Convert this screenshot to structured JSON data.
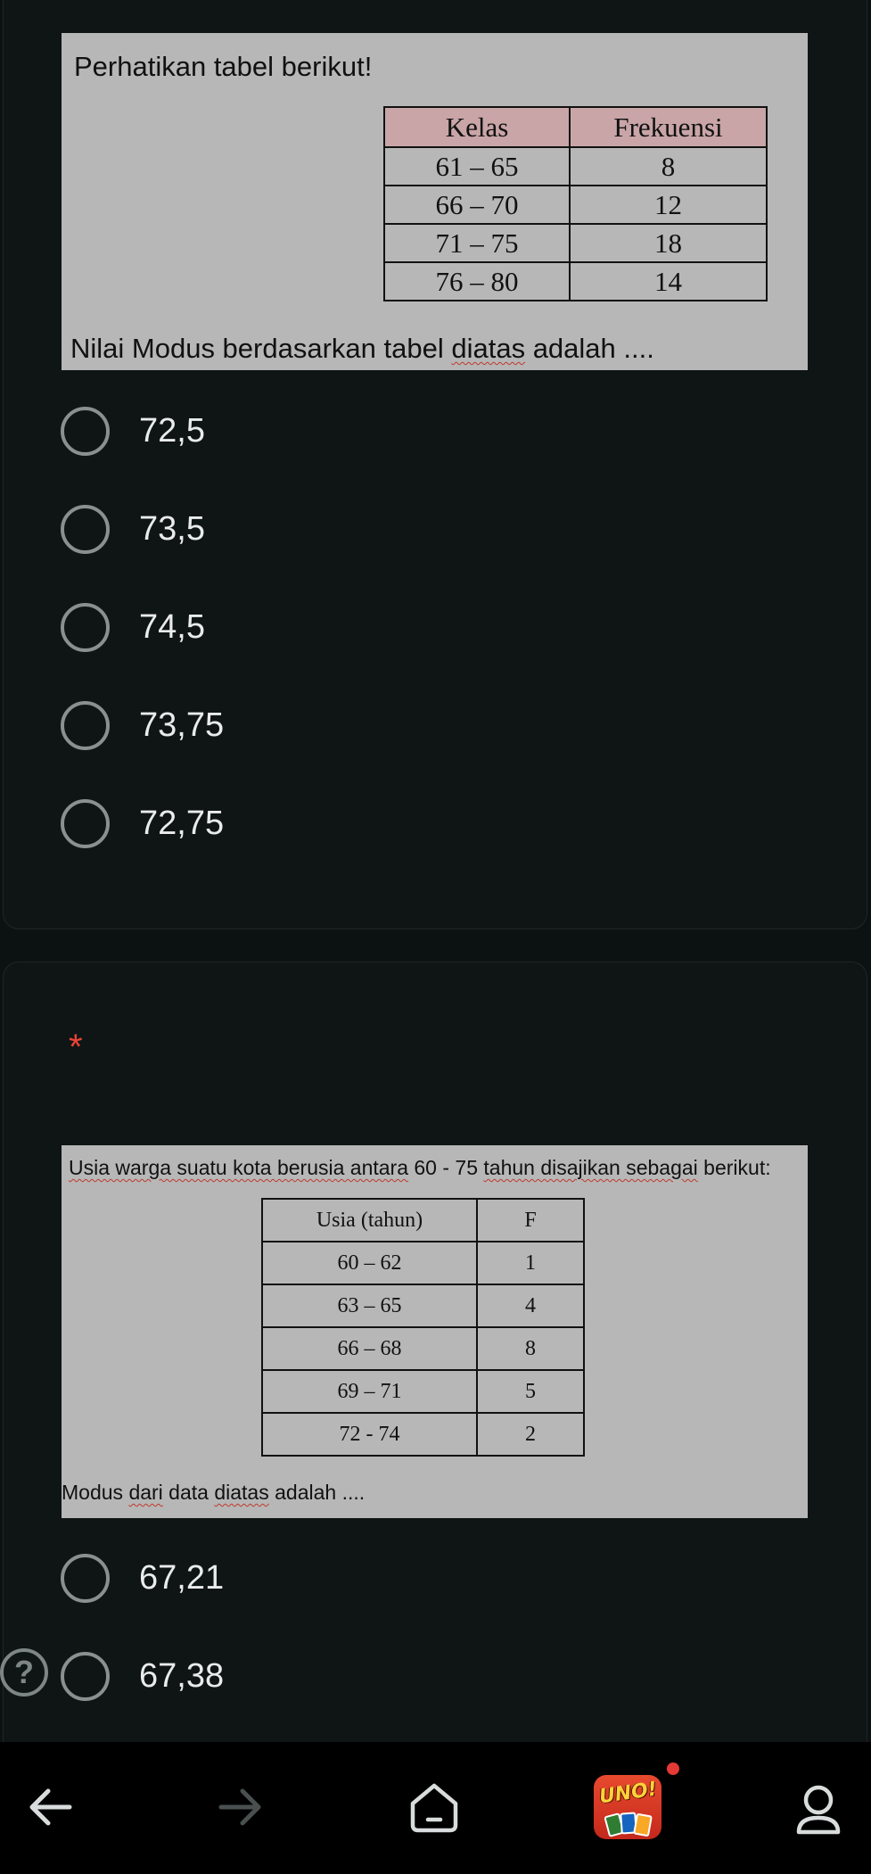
{
  "question1": {
    "image": {
      "heading": "Perhatikan tabel berikut!",
      "table": {
        "headers": [
          "Kelas",
          "Frekuensi"
        ],
        "rows": [
          [
            "61 – 65",
            "8"
          ],
          [
            "66 – 70",
            "12"
          ],
          [
            "71 – 75",
            "18"
          ],
          [
            "76 – 80",
            "14"
          ]
        ]
      },
      "prompt_before": "Nilai Modus berdasarkan tabel ",
      "prompt_squiggle": "diatas",
      "prompt_after": " adalah ...."
    },
    "options": [
      "72,5",
      "73,5",
      "74,5",
      "73,75",
      "72,75"
    ]
  },
  "question2": {
    "required_marker": "*",
    "image": {
      "heading_parts": [
        {
          "text": "Usia warga suatu kota berusia antara",
          "squiggle": true
        },
        {
          "text": " 60 - 75 ",
          "squiggle": false
        },
        {
          "text": "tahun disajikan sebagai",
          "squiggle": true
        },
        {
          "text": " berikut:",
          "squiggle": false
        }
      ],
      "table": {
        "headers": [
          "Usia (tahun)",
          "F"
        ],
        "rows": [
          [
            "60 – 62",
            "1"
          ],
          [
            "63 – 65",
            "4"
          ],
          [
            "66 – 68",
            "8"
          ],
          [
            "69 – 71",
            "5"
          ],
          [
            "72 - 74",
            "2"
          ]
        ]
      },
      "prompt_parts": [
        {
          "text": "Modus ",
          "squiggle": false
        },
        {
          "text": "dari",
          "squiggle": true
        },
        {
          "text": " data ",
          "squiggle": false
        },
        {
          "text": "diatas",
          "squiggle": true
        },
        {
          "text": " adalah ....",
          "squiggle": false
        }
      ]
    },
    "options": [
      "67,21",
      "67,38"
    ]
  },
  "help_icon": "question-mark",
  "uno_logo_text": "UNO!",
  "navbar": {
    "items": [
      "back-arrow-icon",
      "forward-arrow-icon",
      "home-icon",
      "uno-app-icon",
      "profile-icon"
    ],
    "badge_color": "#e53935"
  },
  "colors": {
    "background": "#0c1212",
    "required": "#ea4335",
    "image_bg": "#b7b7b7",
    "table_header_q1": "#c9a5a7"
  }
}
